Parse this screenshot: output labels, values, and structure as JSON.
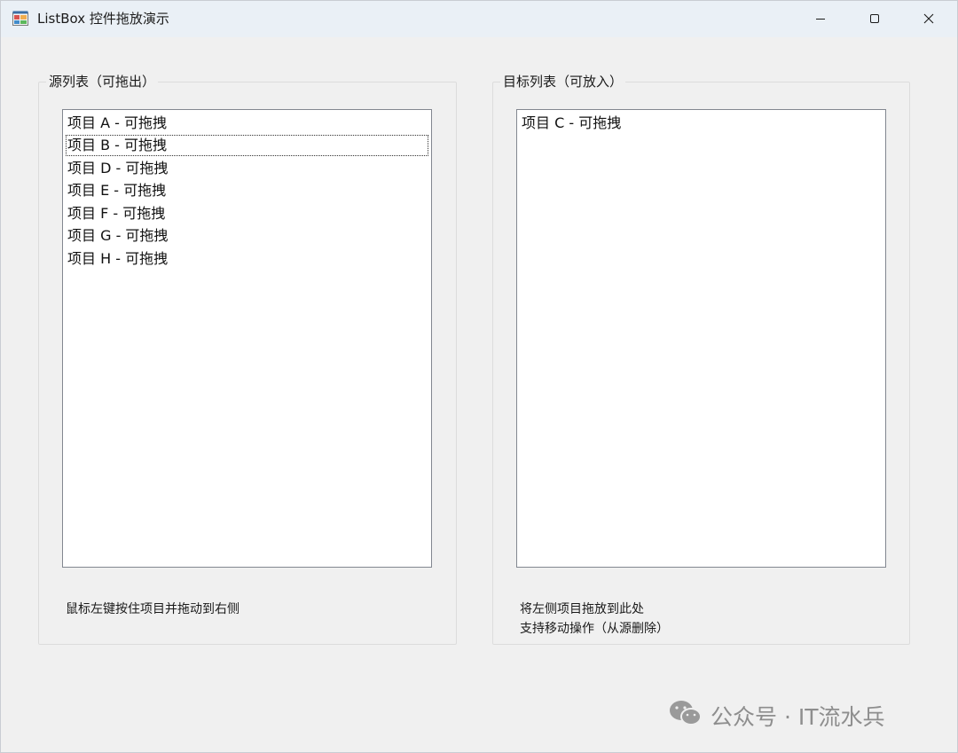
{
  "window": {
    "title": "ListBox 控件拖放演示",
    "icon": "winforms-app-icon"
  },
  "caption_buttons": [
    "minimize-icon",
    "maximize-icon",
    "close-icon"
  ],
  "source": {
    "group_title": "源列表（可拖出）",
    "items": [
      "项目 A - 可拖拽",
      "项目 B - 可拖拽",
      "项目 D - 可拖拽",
      "项目 E - 可拖拽",
      "项目 F - 可拖拽",
      "项目 G - 可拖拽",
      "项目 H - 可拖拽"
    ],
    "focused_item": "项目 B - 可拖拽",
    "hint": "鼠标左键按住项目并拖动到右侧"
  },
  "target": {
    "group_title": "目标列表（可放入）",
    "items": [
      "项目 C - 可拖拽"
    ],
    "hint_line1": "将左侧项目拖放到此处",
    "hint_line2": "支持移动操作（从源删除）"
  },
  "watermark": {
    "text": "公众号 · IT流水兵",
    "icon": "wechat-icon"
  }
}
